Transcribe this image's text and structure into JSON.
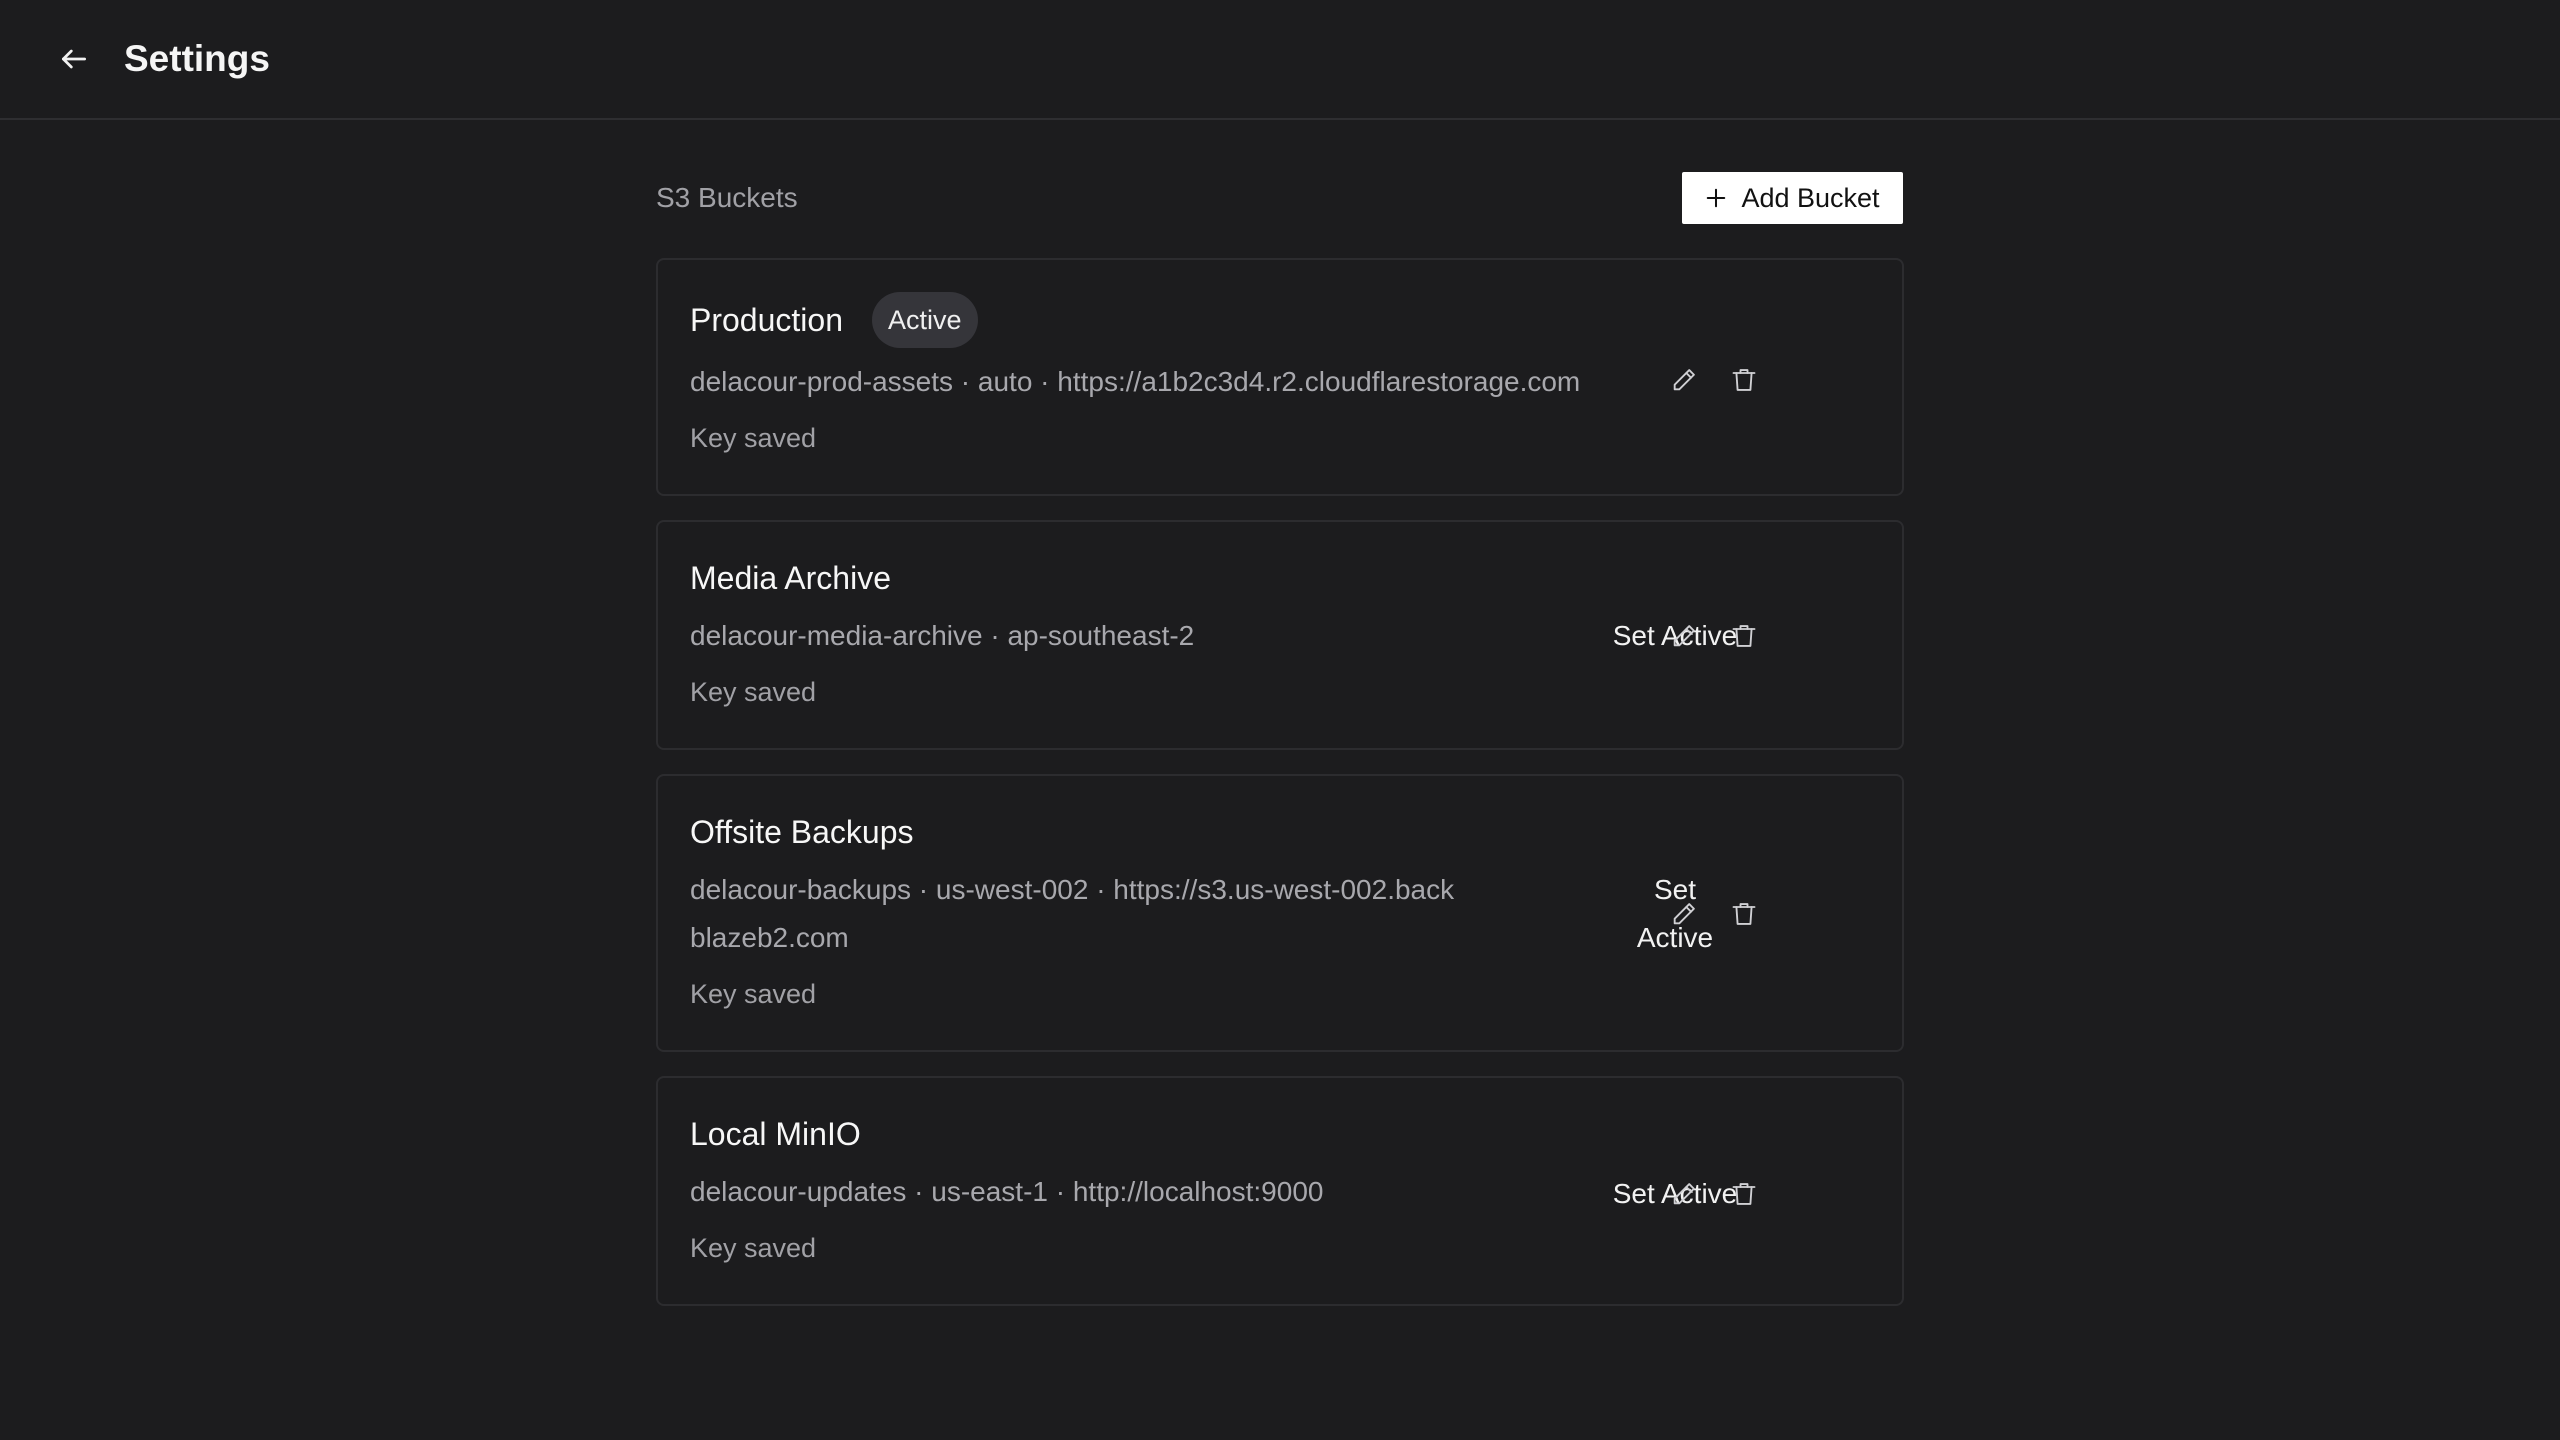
{
  "header": {
    "title": "Settings",
    "back_icon": "arrow-left-icon"
  },
  "section": {
    "title": "S3 Buckets",
    "add_button_label": "Add Bucket",
    "add_icon": "plus-icon"
  },
  "buckets": [
    {
      "name": "Production",
      "status_badge": "Active",
      "details": "delacour-prod-assets · auto · https://a1b2c3d4.r2.cloudflarestorage.com",
      "key_status": "Key saved",
      "is_active": true
    },
    {
      "name": "Media Archive",
      "details": "delacour-media-archive · ap-southeast-2",
      "key_status": "Key saved",
      "set_active_label": "Set Active",
      "is_active": false
    },
    {
      "name": "Offsite Backups",
      "details": "delacour-backups · us-west-002 · https://s3.us-west-002.backblazeb2.com",
      "key_status": "Key saved",
      "set_active_label": "Set Active",
      "is_active": false
    },
    {
      "name": "Local MinIO",
      "details": "delacour-updates · us-east-1 · http://localhost:9000",
      "key_status": "Key saved",
      "set_active_label": "Set Active",
      "is_active": false
    }
  ],
  "icons": {
    "edit": "pencil-icon",
    "delete": "trash-icon"
  },
  "colors": {
    "background": "#1c1c1e",
    "card_border": "#2c2c2f",
    "badge_bg": "#35353a",
    "primary_button_bg": "#ffffff",
    "muted_text": "#a1a1a6"
  }
}
